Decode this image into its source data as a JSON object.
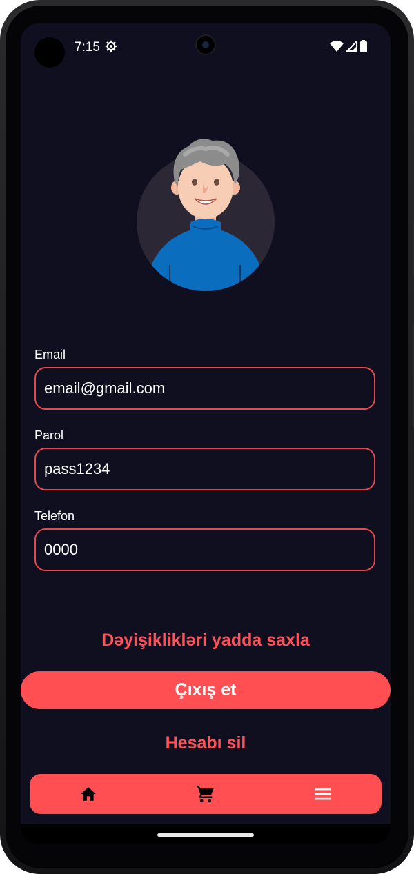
{
  "status_bar": {
    "time": "7:15"
  },
  "form": {
    "email_label": "Email",
    "email_value": "email@gmail.com",
    "password_label": "Parol",
    "password_value": "pass1234",
    "phone_label": "Telefon",
    "phone_value": "0000"
  },
  "actions": {
    "save_label": "Dəyişiklikləri yadda saxla",
    "logout_label": "Çıxış et",
    "delete_label": "Hesabı sil"
  },
  "bottom_nav": {
    "items": [
      {
        "icon": "home-icon"
      },
      {
        "icon": "cart-icon"
      },
      {
        "icon": "menu-icon"
      }
    ]
  },
  "colors": {
    "background": "#100f1f",
    "accent": "#ff4f53",
    "field_border": "#e6484d",
    "text": "#ffffff"
  }
}
